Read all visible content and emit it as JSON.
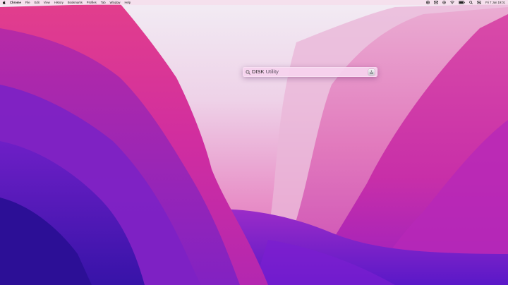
{
  "menubar": {
    "app_name": "Chrome",
    "menus": [
      "File",
      "Edit",
      "View",
      "History",
      "Bookmarks",
      "Profiles",
      "Tab",
      "Window",
      "Help"
    ],
    "clock": "Fri 7 Jan 19:01",
    "status_icons": [
      "record-icon",
      "mail-icon",
      "spotlight-icon",
      "wifi-icon",
      "battery-icon",
      "search-icon",
      "control-center-icon"
    ]
  },
  "spotlight": {
    "typed": "DISK",
    "completion": " Utility",
    "result_icon": "disk-utility-icon"
  },
  "colors": {
    "wallpaper_top": "#f0e4f0",
    "wallpaper_magenta": "#d23ca8",
    "wallpaper_purple": "#6a1fd0",
    "wallpaper_deep": "#2a10a0",
    "spotlight_bg": "#f6d2ee"
  }
}
